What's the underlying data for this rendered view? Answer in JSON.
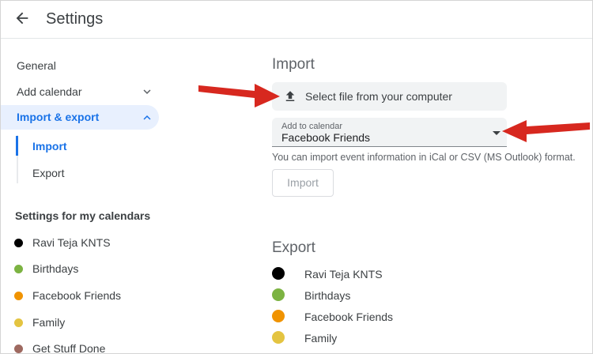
{
  "header": {
    "title": "Settings"
  },
  "accent": {
    "blue": "#1a73e8",
    "pill_background": "#e8f0fe",
    "arrow_red": "#d7281f",
    "field_background": "#f1f3f4"
  },
  "sidebar": {
    "items": [
      {
        "label": "General"
      },
      {
        "label": "Add calendar",
        "chevron": "down"
      },
      {
        "label": "Import & export",
        "chevron": "up",
        "active": true
      }
    ],
    "subitems": [
      {
        "label": "Import",
        "selected": true
      },
      {
        "label": "Export",
        "selected": false
      }
    ],
    "section_title": "Settings for my calendars",
    "calendars": [
      {
        "label": "Ravi Teja KNTS",
        "color": "#000000"
      },
      {
        "label": "Birthdays",
        "color": "#7CB342"
      },
      {
        "label": "Facebook Friends",
        "color": "#F09300"
      },
      {
        "label": "Family",
        "color": "#E4C441"
      },
      {
        "label": "Get Stuff Done",
        "color": "#9E6960"
      }
    ]
  },
  "import_section": {
    "heading": "Import",
    "select_file_label": "Select file from your computer",
    "dropdown_label": "Add to calendar",
    "dropdown_value": "Facebook Friends",
    "helper_text": "You can import event information in iCal or CSV (MS Outlook) format.",
    "import_button_label": "Import"
  },
  "export_section": {
    "heading": "Export",
    "calendars": [
      {
        "label": "Ravi Teja KNTS",
        "color": "#000000"
      },
      {
        "label": "Birthdays",
        "color": "#7CB342"
      },
      {
        "label": "Facebook Friends",
        "color": "#F09300"
      },
      {
        "label": "Family",
        "color": "#E4C441"
      }
    ]
  }
}
